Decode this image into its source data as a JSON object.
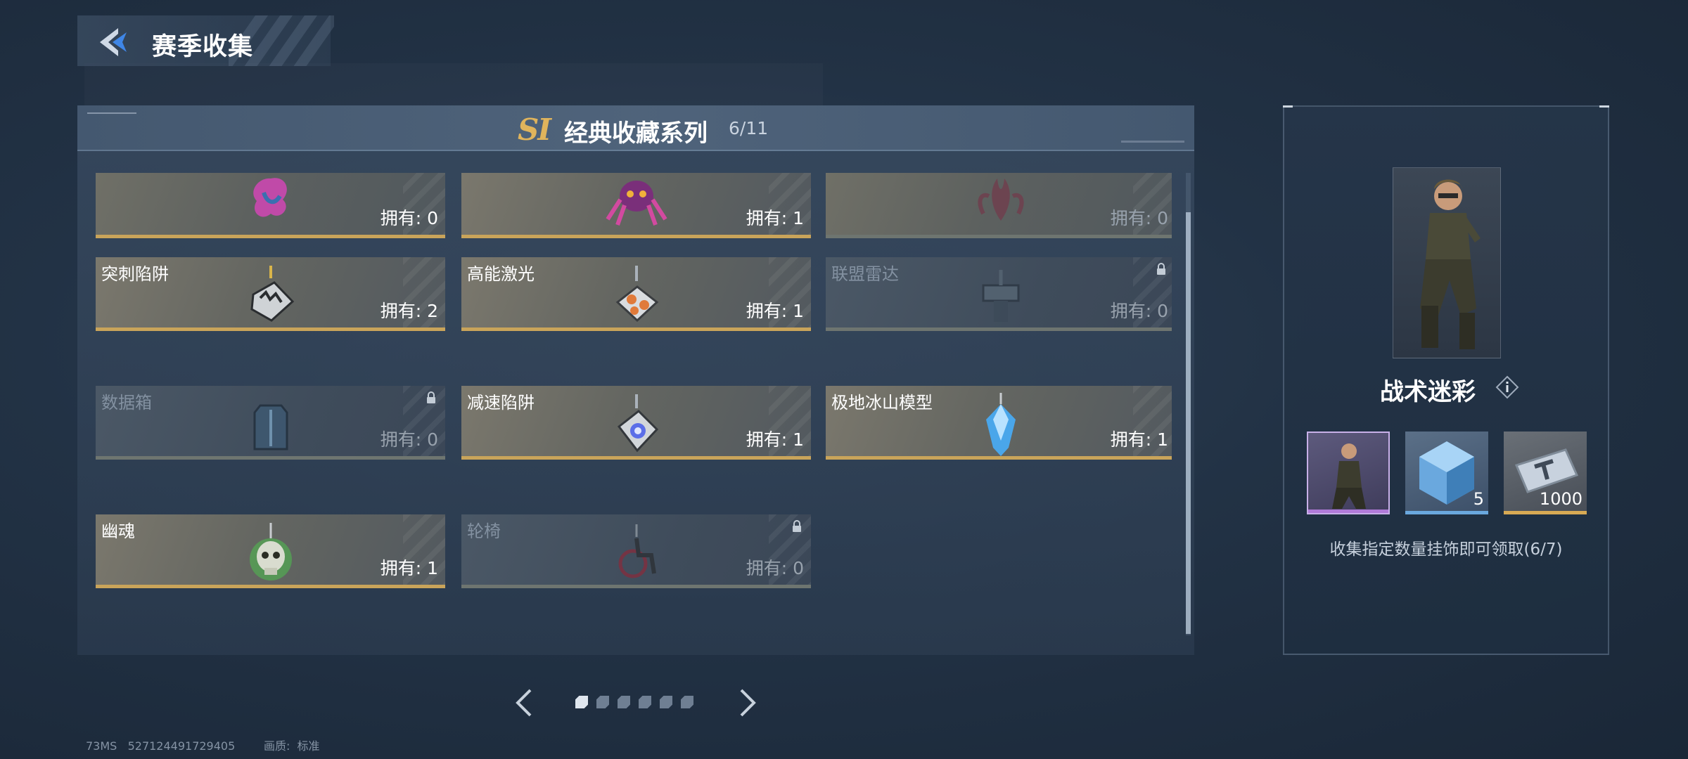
{
  "header": {
    "title": "赛季收集",
    "back_icon": "back-arrow-icon"
  },
  "series": {
    "badge": "SI",
    "title": "经典收藏系列",
    "progress": "6/11"
  },
  "cards": [
    {
      "name": "",
      "owned": "拥有: 0",
      "state": "empty",
      "icon": "pink-flower-icon"
    },
    {
      "name": "",
      "owned": "拥有: 1",
      "state": "owned",
      "icon": "purple-spider-icon"
    },
    {
      "name": "",
      "owned": "拥有: 0",
      "state": "empty",
      "icon": "red-tentacle-icon"
    },
    {
      "name": "突刺陷阱",
      "owned": "拥有: 2",
      "state": "owned",
      "icon": "spike-trap-icon"
    },
    {
      "name": "高能激光",
      "owned": "拥有: 1",
      "state": "owned",
      "icon": "laser-device-icon"
    },
    {
      "name": "联盟雷达",
      "owned": "拥有: 0",
      "state": "locked",
      "icon": "radar-icon"
    },
    {
      "name": "数据箱",
      "owned": "拥有: 0",
      "state": "locked",
      "icon": "data-box-icon"
    },
    {
      "name": "减速陷阱",
      "owned": "拥有: 1",
      "state": "owned",
      "icon": "slow-trap-icon"
    },
    {
      "name": "极地冰山模型",
      "owned": "拥有: 1",
      "state": "owned",
      "icon": "iceberg-icon"
    },
    {
      "name": "幽魂",
      "owned": "拥有: 1",
      "state": "owned",
      "icon": "green-skull-icon"
    },
    {
      "name": "轮椅",
      "owned": "拥有: 0",
      "state": "locked",
      "icon": "wheelchair-icon"
    }
  ],
  "pager": {
    "total_pages": 6,
    "current_page": 1
  },
  "footer": {
    "info": "73MS   527124491729405        画质:  标准"
  },
  "reward": {
    "title": "战术迷彩",
    "items": [
      {
        "icon": "character-skin-icon",
        "rarity": "epic",
        "qty": ""
      },
      {
        "icon": "blue-cube-icon",
        "rarity": "rare",
        "qty": "5"
      },
      {
        "icon": "silver-ticket-icon",
        "rarity": "gold",
        "qty": "1000"
      }
    ],
    "description": "收集指定数量挂饰即可领取(6/7)"
  },
  "colors": {
    "accent_gold": "#c9a45a",
    "badge_gold": "#e0b45c",
    "locked_bar": "#6e7570"
  }
}
